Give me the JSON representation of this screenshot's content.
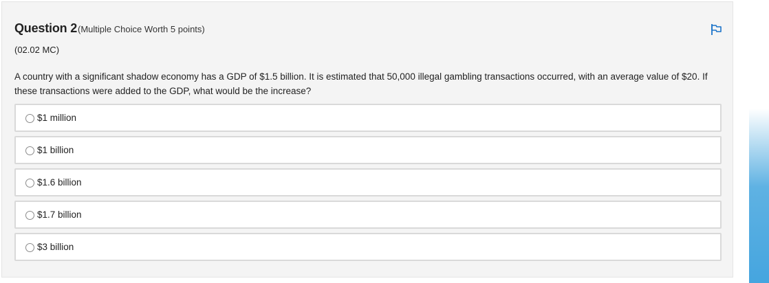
{
  "question": {
    "title": "Question 2",
    "meta": "(Multiple Choice Worth 5 points)",
    "code": "(02.02 MC)",
    "text": "A country with a significant shadow economy has a GDP of $1.5 billion. It is estimated that 50,000 illegal gambling transactions occurred, with an average value of $20. If these transactions were added to the GDP, what would be the increase?",
    "flag_icon": "flag-icon"
  },
  "choices": [
    {
      "label": "$1 million"
    },
    {
      "label": "$1 billion"
    },
    {
      "label": "$1.6 billion"
    },
    {
      "label": "$1.7 billion"
    },
    {
      "label": "$3 billion"
    }
  ],
  "colors": {
    "accent": "#1a73c9",
    "card_bg": "#f4f4f4",
    "choice_border": "#d9d9d9",
    "side_bar": "#45a5df"
  }
}
